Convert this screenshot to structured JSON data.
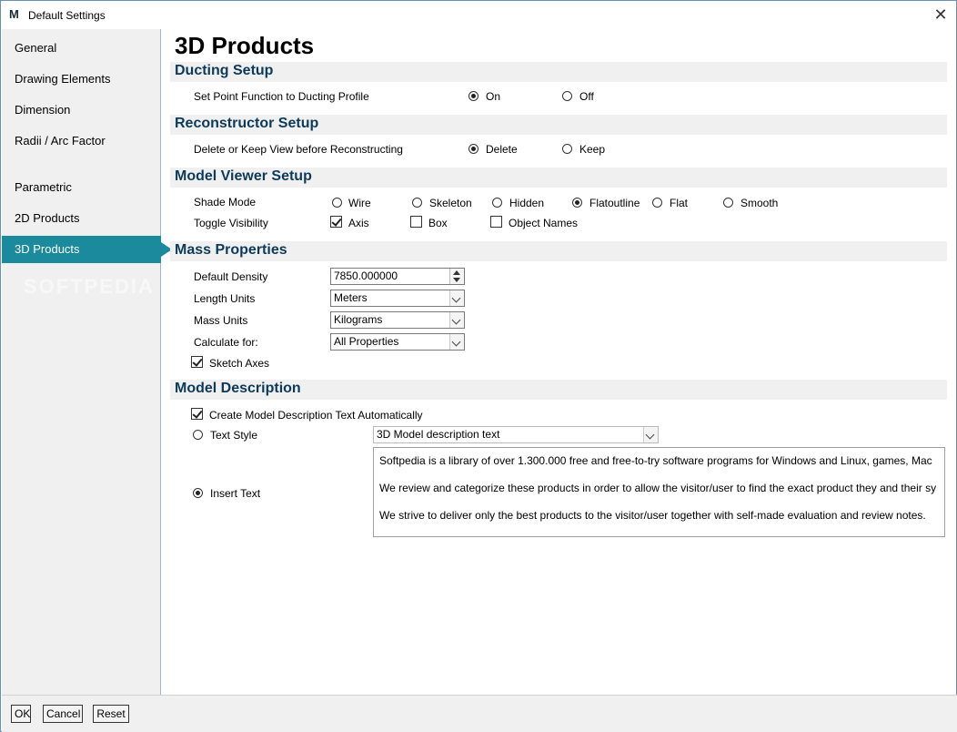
{
  "window": {
    "title": "Default Settings",
    "logo": "M"
  },
  "sidebar": {
    "items": [
      {
        "label": "General"
      },
      {
        "label": "Drawing Elements"
      },
      {
        "label": "Dimension"
      },
      {
        "label": "Radii / Arc Factor"
      },
      {
        "label": "Parametric"
      },
      {
        "label": "2D Products"
      },
      {
        "label": "3D Products"
      }
    ],
    "active": "3D Products",
    "watermark": "SOFTPEDIA"
  },
  "page": {
    "title": "3D Products"
  },
  "ducting": {
    "title": "Ducting Setup",
    "row_label": "Set Point Function to Ducting Profile",
    "on": "On",
    "off": "Off"
  },
  "reconstructor": {
    "title": "Reconstructor Setup",
    "row_label": "Delete or Keep View before Reconstructing",
    "delete": "Delete",
    "keep": "Keep"
  },
  "viewer": {
    "title": "Model Viewer Setup",
    "shade_label": "Shade Mode",
    "shade_options": [
      "Wire",
      "Skeleton",
      "Hidden",
      "Flatoutline",
      "Flat",
      "Smooth"
    ],
    "shade_selected": "Flatoutline",
    "visibility_label": "Toggle Visibility",
    "axis": "Axis",
    "box": "Box",
    "object_names": "Object Names"
  },
  "mass": {
    "title": "Mass Properties",
    "density_label": "Default Density",
    "density_value": "7850.000000",
    "length_label": "Length Units",
    "length_value": "Meters",
    "mass_label": "Mass Units",
    "mass_value": "Kilograms",
    "calc_label": "Calculate for:",
    "calc_value": "All Properties",
    "sketch_axes": "Sketch Axes"
  },
  "description": {
    "title": "Model Description",
    "auto_label": "Create Model Description Text Automatically",
    "text_style_label": "Text Style",
    "text_style_value": "3D Model description text",
    "insert_text_label": "Insert Text",
    "text_lines": [
      "Softpedia is a library of over 1.300.000 free and free-to-try software programs for Windows and Linux, games, Mac",
      "We review and categorize these products in order to allow the visitor/user to find the exact product they and their sy",
      "We strive to deliver only the best products to the visitor/user together with self-made evaluation and review notes."
    ]
  },
  "footer": {
    "ok": "OK",
    "cancel": "Cancel",
    "reset": "Reset"
  },
  "colors": {
    "accent": "#1a8a9c",
    "section_text": "#0e3a5a",
    "section_bg": "#f0f0f0"
  }
}
